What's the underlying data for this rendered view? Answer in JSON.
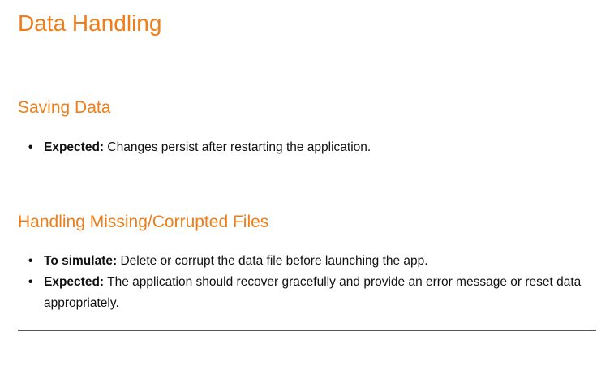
{
  "title": "Data Handling",
  "sections": [
    {
      "heading": "Saving Data",
      "items": [
        {
          "label": "Expected:",
          "text": " Changes persist after restarting the application."
        }
      ]
    },
    {
      "heading": "Handling Missing/Corrupted Files",
      "items": [
        {
          "label": "To simulate:",
          "text": " Delete or corrupt the data file before launching the app."
        },
        {
          "label": "Expected:",
          "text": " The application should recover gracefully and provide an error message or reset data appropriately."
        }
      ]
    }
  ],
  "colors": {
    "heading": "#f07d18",
    "text": "#111111",
    "rule": "#555555"
  }
}
